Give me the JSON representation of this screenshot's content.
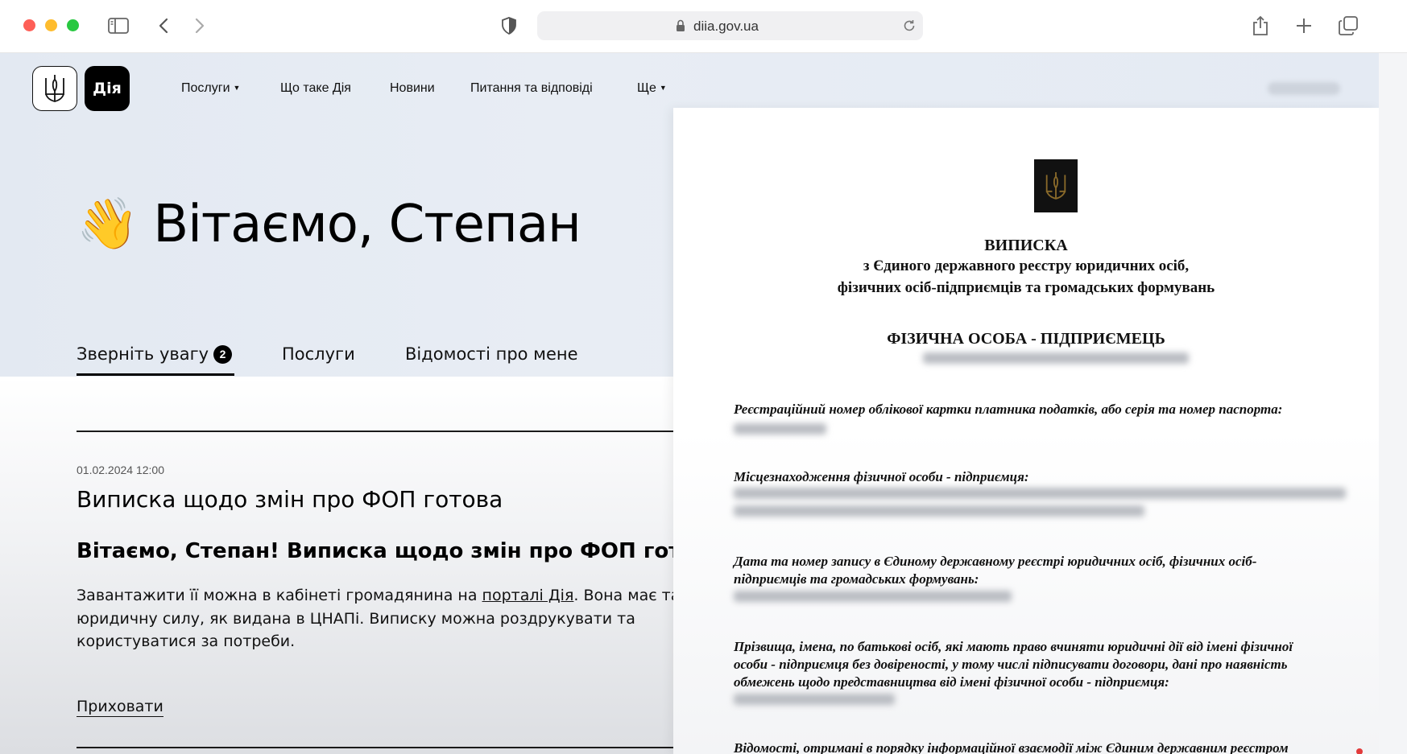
{
  "browser": {
    "url": "diia.gov.ua",
    "icons": [
      "sidebar-icon",
      "back-icon",
      "forward-icon",
      "privacy-shield-icon",
      "lock-icon",
      "reload-icon",
      "share-icon",
      "new-tab-icon",
      "tabs-overview-icon"
    ]
  },
  "header": {
    "logo_text": "Дія",
    "nav": [
      {
        "label": "Послуги",
        "has_caret": true
      },
      {
        "label": "Що таке Дія",
        "has_caret": false
      },
      {
        "label": "Новини",
        "has_caret": false
      },
      {
        "label": "Питання та відповіді",
        "has_caret": false
      },
      {
        "label": "Ще",
        "has_caret": true
      }
    ]
  },
  "hero": {
    "emoji": "👋",
    "greeting": "Вітаємо, Степан"
  },
  "tabs": {
    "attention": "Зверніть увагу",
    "attention_count": "2",
    "services": "Послуги",
    "about_me": "Відомості про мене"
  },
  "message": {
    "date": "01.02.2024 12:00",
    "title": "Виписка щодо змін про ФОП готова",
    "subtitle": "Вітаємо, Степан! Виписка щодо змін про ФОП готова",
    "body_1": "Завантажити її можна в кабінеті громадянина на ",
    "body_link": "порталі Дія",
    "body_2": ". Вона має таку ж",
    "body_line2": "юридичну силу, як видана в ЦНАПі. Виписку можна роздрукувати та",
    "body_line3": "користуватися за потреби.",
    "hide": "Приховати"
  },
  "document": {
    "title": "ВИПИСКА",
    "subtitle_1": "з Єдиного державного реєстру юридичних осіб,",
    "subtitle_2": "фізичних осіб-підприємців та громадських формувань",
    "kind": "ФІЗИЧНА ОСОБА - ПІДПРИЄМЕЦЬ",
    "field_tax": "Реєстраційний номер облікової картки платника податків, або серія та номер паспорта:",
    "field_location": "Місцезнаходження фізичної особи - підприємця:",
    "field_date_1": "Дата та номер запису в Єдиному державному реєстрі юридичних осіб, фізичних осіб-",
    "field_date_2": "підприємців та громадських формувань:",
    "field_persons_1": "Прізвища, імена, по батькові осіб, які мають право вчиняти юридичні дії від імені фізичної",
    "field_persons_2": "особи - підприємця без довіреності, у тому числі підписувати договори, дані про наявність",
    "field_persons_3": "обмежень щодо представництва від імені фізичної особи - підприємця:",
    "field_info": "Відомості, отримані в порядку інформаційної взаємодії між Єдиним державним реєстром"
  }
}
